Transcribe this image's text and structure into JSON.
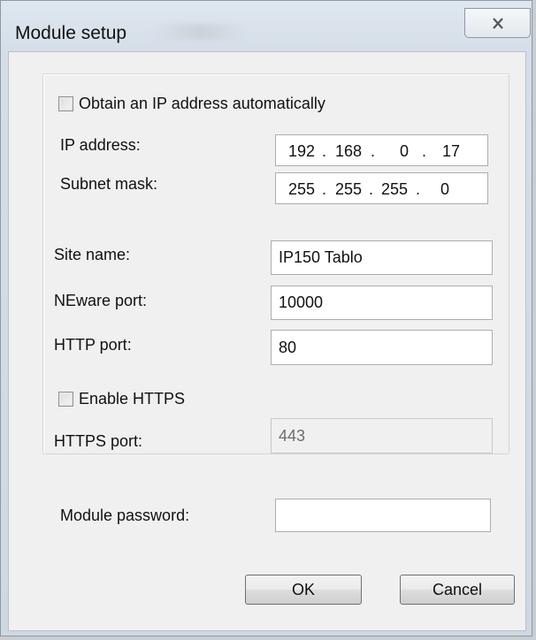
{
  "window": {
    "title": "Module setup",
    "close_icon": "close-icon"
  },
  "network": {
    "auto_ip_label": "Obtain an IP address automatically",
    "auto_ip_checked": false,
    "ip_label": "IP address:",
    "ip_octets": [
      "192",
      "168",
      "0",
      "17"
    ],
    "subnet_label": "Subnet mask:",
    "subnet_octets": [
      "255",
      "255",
      "255",
      "0"
    ]
  },
  "site": {
    "site_name_label": "Site name:",
    "site_name_value": "IP150 Tablo",
    "neware_port_label": "NEware port:",
    "neware_port_value": "10000",
    "http_port_label": "HTTP port:",
    "http_port_value": "80",
    "https_enable_label": "Enable HTTPS",
    "https_enable_checked": false,
    "https_port_label": "HTTPS port:",
    "https_port_value": "443"
  },
  "security": {
    "password_label": "Module password:",
    "password_value": ""
  },
  "buttons": {
    "ok_label": "OK",
    "cancel_label": "Cancel"
  }
}
